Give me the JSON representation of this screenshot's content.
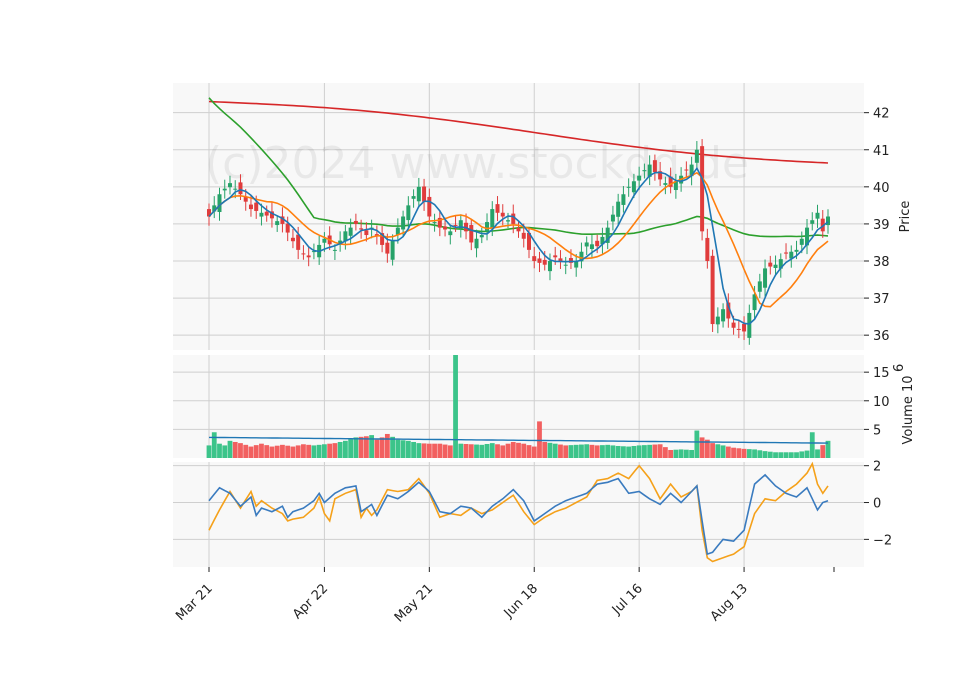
{
  "watermark": "(c)2024 www.stockdd.de",
  "chart_data": {
    "type": "candlestick",
    "panels": {
      "price": {
        "ylabel": "Price",
        "ylim": [
          35.6,
          42.8
        ],
        "yticks": [
          36,
          37,
          38,
          39,
          40,
          41,
          42
        ]
      },
      "volume": {
        "ylabel": "Volume",
        "ylabel_exp": "10",
        "ylabel_exp_power": "6",
        "ylim": [
          0,
          18
        ],
        "yticks": [
          5,
          10,
          15
        ]
      },
      "oscillator": {
        "ylim": [
          -3.5,
          2.2
        ],
        "yticks": [
          -2,
          0,
          2
        ],
        "yticklabels": [
          "−2",
          "0",
          "2"
        ]
      }
    },
    "x_ticks": [
      {
        "label": "Mar 21",
        "index": 0
      },
      {
        "label": "Apr 22",
        "index": 22
      },
      {
        "label": "May 21",
        "index": 42
      },
      {
        "label": "Jun 18",
        "index": 62
      },
      {
        "label": "Jul 16",
        "index": 82
      },
      {
        "label": "Aug 13",
        "index": 102
      }
    ],
    "n": 119,
    "colors": {
      "up": "#26a269",
      "down": "#e03c3c",
      "sma_fast": "#1f77b4",
      "sma_mid": "#ff7f0e",
      "sma_slow": "#2ca02c",
      "sma_long": "#d62728",
      "osc_a": "#3a7bbf",
      "osc_b": "#f5a11a",
      "vol_avg": "#1f77b4"
    },
    "close_anchors": [
      [
        0,
        39.2
      ],
      [
        2,
        39.8
      ],
      [
        4,
        40.1
      ],
      [
        6,
        39.8
      ],
      [
        8,
        39.4
      ],
      [
        10,
        39.3
      ],
      [
        14,
        39.0
      ],
      [
        17,
        38.3
      ],
      [
        19,
        38.1
      ],
      [
        22,
        38.6
      ],
      [
        24,
        38.3
      ],
      [
        26,
        38.8
      ],
      [
        28,
        39.0
      ],
      [
        30,
        38.7
      ],
      [
        31,
        38.9
      ],
      [
        34,
        38.2
      ],
      [
        36,
        38.9
      ],
      [
        38,
        39.5
      ],
      [
        40,
        40.0
      ],
      [
        42,
        39.2
      ],
      [
        44,
        38.9
      ],
      [
        46,
        38.8
      ],
      [
        48,
        39.1
      ],
      [
        50,
        38.5
      ],
      [
        52,
        38.7
      ],
      [
        54,
        39.4
      ],
      [
        56,
        39.2
      ],
      [
        58,
        39.0
      ],
      [
        60,
        38.6
      ],
      [
        62,
        38.0
      ],
      [
        64,
        37.9
      ],
      [
        66,
        38.1
      ],
      [
        68,
        37.9
      ],
      [
        70,
        38.0
      ],
      [
        72,
        38.5
      ],
      [
        74,
        38.4
      ],
      [
        76,
        38.9
      ],
      [
        78,
        39.6
      ],
      [
        80,
        40.0
      ],
      [
        82,
        40.3
      ],
      [
        84,
        40.6
      ],
      [
        86,
        40.2
      ],
      [
        88,
        40.0
      ],
      [
        90,
        40.3
      ],
      [
        92,
        40.6
      ],
      [
        93,
        41.0
      ],
      [
        94,
        38.8
      ],
      [
        95,
        38.0
      ],
      [
        96,
        36.3
      ],
      [
        98,
        36.7
      ],
      [
        100,
        36.2
      ],
      [
        102,
        36.1
      ],
      [
        104,
        37.1
      ],
      [
        106,
        37.8
      ],
      [
        108,
        37.9
      ],
      [
        110,
        38.2
      ],
      [
        112,
        38.3
      ],
      [
        114,
        38.9
      ],
      [
        116,
        39.3
      ],
      [
        117,
        38.8
      ],
      [
        118,
        39.2
      ]
    ],
    "volume_anchors": [
      [
        0,
        2.2
      ],
      [
        1,
        4.5
      ],
      [
        2,
        2.5
      ],
      [
        3,
        2.2
      ],
      [
        4,
        3.0
      ],
      [
        6,
        2.6
      ],
      [
        8,
        2.0
      ],
      [
        10,
        2.5
      ],
      [
        12,
        2.0
      ],
      [
        14,
        2.3
      ],
      [
        16,
        2.0
      ],
      [
        18,
        2.4
      ],
      [
        20,
        2.2
      ],
      [
        24,
        2.6
      ],
      [
        26,
        3.0
      ],
      [
        28,
        3.6
      ],
      [
        30,
        3.8
      ],
      [
        31,
        4.0
      ],
      [
        32,
        3.2
      ],
      [
        33,
        3.6
      ],
      [
        34,
        4.2
      ],
      [
        36,
        3.2
      ],
      [
        38,
        3.0
      ],
      [
        40,
        2.6
      ],
      [
        42,
        2.5
      ],
      [
        44,
        2.5
      ],
      [
        46,
        2.2
      ],
      [
        47,
        18.0
      ],
      [
        48,
        2.5
      ],
      [
        50,
        2.4
      ],
      [
        52,
        2.3
      ],
      [
        54,
        2.6
      ],
      [
        56,
        2.2
      ],
      [
        58,
        2.8
      ],
      [
        60,
        2.5
      ],
      [
        62,
        2.0
      ],
      [
        63,
        6.4
      ],
      [
        64,
        2.8
      ],
      [
        66,
        2.5
      ],
      [
        68,
        2.2
      ],
      [
        70,
        2.3
      ],
      [
        72,
        2.4
      ],
      [
        74,
        2.2
      ],
      [
        76,
        2.3
      ],
      [
        78,
        2.1
      ],
      [
        80,
        2.0
      ],
      [
        82,
        2.2
      ],
      [
        84,
        2.3
      ],
      [
        86,
        2.4
      ],
      [
        88,
        1.4
      ],
      [
        90,
        1.5
      ],
      [
        92,
        1.4
      ],
      [
        93,
        4.8
      ],
      [
        94,
        3.6
      ],
      [
        95,
        3.2
      ],
      [
        96,
        2.6
      ],
      [
        98,
        2.2
      ],
      [
        100,
        1.8
      ],
      [
        102,
        1.6
      ],
      [
        104,
        1.5
      ],
      [
        106,
        1.2
      ],
      [
        108,
        1.0
      ],
      [
        110,
        1.0
      ],
      [
        112,
        1.0
      ],
      [
        114,
        1.3
      ],
      [
        115,
        4.5
      ],
      [
        116,
        1.5
      ],
      [
        118,
        3.0
      ]
    ],
    "osc_a_anchors": [
      [
        0,
        0.1
      ],
      [
        2,
        0.8
      ],
      [
        4,
        0.5
      ],
      [
        6,
        -0.2
      ],
      [
        8,
        0.3
      ],
      [
        9,
        -0.7
      ],
      [
        10,
        -0.3
      ],
      [
        12,
        -0.5
      ],
      [
        14,
        -0.2
      ],
      [
        15,
        -0.8
      ],
      [
        16,
        -0.5
      ],
      [
        18,
        -0.3
      ],
      [
        20,
        0.1
      ],
      [
        21,
        0.5
      ],
      [
        22,
        0.0
      ],
      [
        24,
        0.5
      ],
      [
        26,
        0.8
      ],
      [
        28,
        0.9
      ],
      [
        29,
        -0.5
      ],
      [
        30,
        -0.3
      ],
      [
        31,
        -0.1
      ],
      [
        32,
        -0.7
      ],
      [
        34,
        0.4
      ],
      [
        36,
        0.2
      ],
      [
        38,
        0.6
      ],
      [
        40,
        1.1
      ],
      [
        42,
        0.6
      ],
      [
        44,
        -0.5
      ],
      [
        46,
        -0.6
      ],
      [
        48,
        -0.2
      ],
      [
        50,
        -0.3
      ],
      [
        52,
        -0.8
      ],
      [
        54,
        -0.2
      ],
      [
        56,
        0.2
      ],
      [
        58,
        0.7
      ],
      [
        60,
        0.1
      ],
      [
        62,
        -1.0
      ],
      [
        64,
        -0.6
      ],
      [
        66,
        -0.2
      ],
      [
        68,
        0.1
      ],
      [
        70,
        0.3
      ],
      [
        72,
        0.5
      ],
      [
        74,
        1.0
      ],
      [
        76,
        1.1
      ],
      [
        78,
        1.3
      ],
      [
        80,
        0.5
      ],
      [
        82,
        0.6
      ],
      [
        84,
        0.2
      ],
      [
        86,
        -0.1
      ],
      [
        88,
        0.5
      ],
      [
        90,
        0.0
      ],
      [
        92,
        0.6
      ],
      [
        93,
        0.9
      ],
      [
        94,
        -1.0
      ],
      [
        95,
        -2.8
      ],
      [
        96,
        -2.7
      ],
      [
        98,
        -2.0
      ],
      [
        100,
        -2.1
      ],
      [
        102,
        -1.5
      ],
      [
        104,
        1.0
      ],
      [
        106,
        1.5
      ],
      [
        108,
        0.9
      ],
      [
        110,
        0.5
      ],
      [
        112,
        0.3
      ],
      [
        114,
        0.8
      ],
      [
        116,
        -0.4
      ],
      [
        117,
        0.0
      ],
      [
        118,
        0.1
      ]
    ],
    "osc_b_anchors": [
      [
        0,
        -1.5
      ],
      [
        2,
        -0.4
      ],
      [
        4,
        0.6
      ],
      [
        6,
        -0.3
      ],
      [
        8,
        0.6
      ],
      [
        9,
        -0.2
      ],
      [
        10,
        0.1
      ],
      [
        12,
        -0.3
      ],
      [
        14,
        -0.6
      ],
      [
        15,
        -1.0
      ],
      [
        16,
        -0.9
      ],
      [
        18,
        -0.8
      ],
      [
        20,
        -0.3
      ],
      [
        21,
        0.3
      ],
      [
        22,
        -0.6
      ],
      [
        23,
        -1.0
      ],
      [
        24,
        0.2
      ],
      [
        26,
        0.5
      ],
      [
        28,
        0.7
      ],
      [
        29,
        -0.8
      ],
      [
        30,
        -0.3
      ],
      [
        31,
        -0.7
      ],
      [
        32,
        -0.4
      ],
      [
        34,
        0.7
      ],
      [
        36,
        0.6
      ],
      [
        38,
        0.7
      ],
      [
        40,
        1.3
      ],
      [
        42,
        0.5
      ],
      [
        44,
        -0.8
      ],
      [
        46,
        -0.6
      ],
      [
        48,
        -0.7
      ],
      [
        50,
        -0.3
      ],
      [
        52,
        -0.6
      ],
      [
        54,
        -0.4
      ],
      [
        56,
        0.0
      ],
      [
        58,
        0.4
      ],
      [
        60,
        -0.5
      ],
      [
        62,
        -1.2
      ],
      [
        64,
        -0.8
      ],
      [
        66,
        -0.5
      ],
      [
        68,
        -0.3
      ],
      [
        70,
        0.0
      ],
      [
        72,
        0.3
      ],
      [
        74,
        1.2
      ],
      [
        76,
        1.3
      ],
      [
        78,
        1.6
      ],
      [
        80,
        1.3
      ],
      [
        82,
        2.0
      ],
      [
        84,
        1.3
      ],
      [
        86,
        0.2
      ],
      [
        88,
        1.0
      ],
      [
        90,
        0.3
      ],
      [
        92,
        0.6
      ],
      [
        93,
        0.9
      ],
      [
        94,
        -1.5
      ],
      [
        95,
        -3.0
      ],
      [
        96,
        -3.2
      ],
      [
        98,
        -3.0
      ],
      [
        100,
        -2.8
      ],
      [
        102,
        -2.4
      ],
      [
        104,
        -0.6
      ],
      [
        106,
        0.2
      ],
      [
        108,
        0.1
      ],
      [
        110,
        0.6
      ],
      [
        112,
        1.0
      ],
      [
        114,
        1.6
      ],
      [
        115,
        2.1
      ],
      [
        116,
        1.0
      ],
      [
        117,
        0.5
      ],
      [
        118,
        0.9
      ]
    ]
  }
}
